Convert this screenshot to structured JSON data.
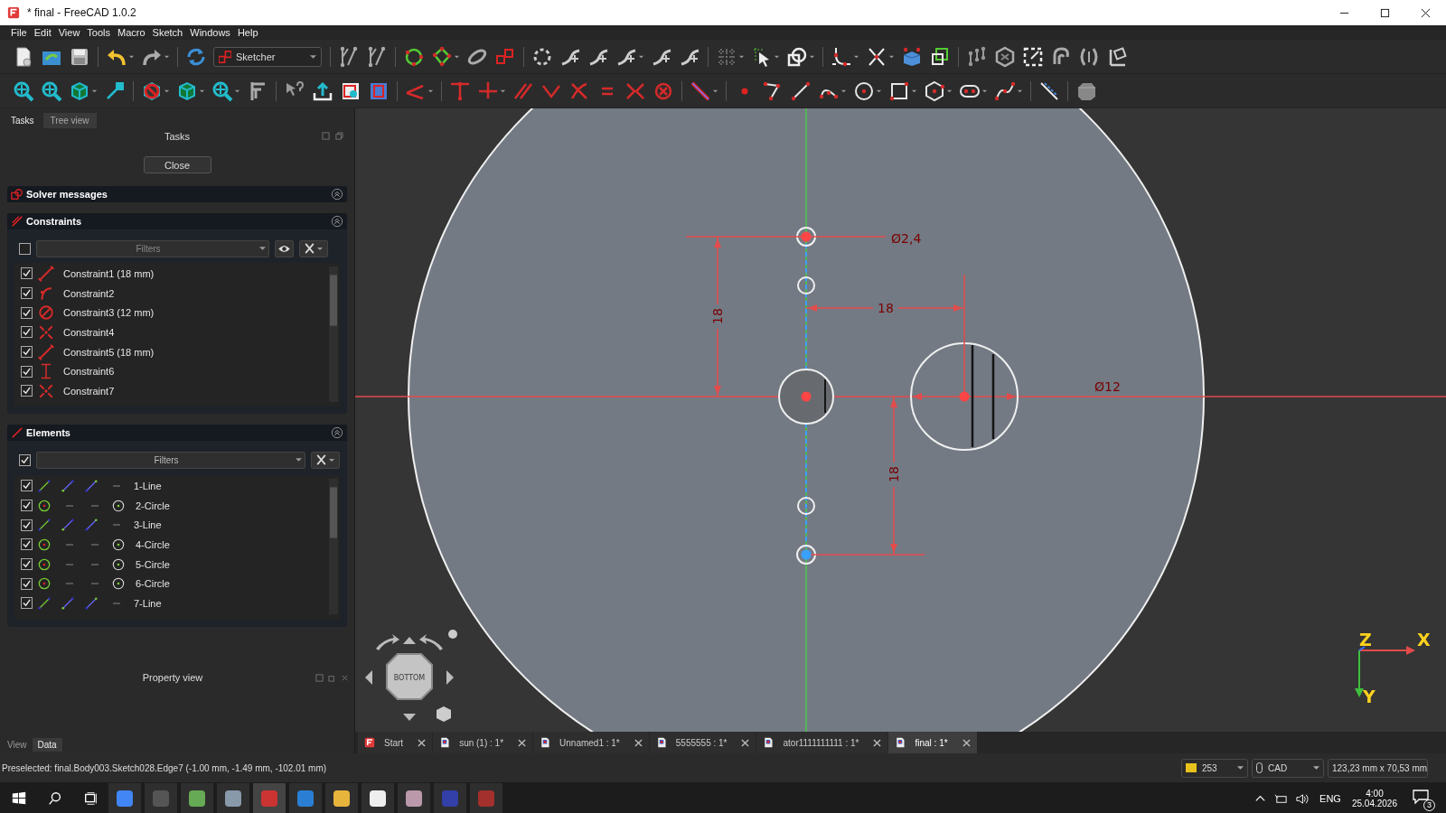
{
  "window": {
    "title": "* final - FreeCAD 1.0.2"
  },
  "menu": [
    "File",
    "Edit",
    "View",
    "Tools",
    "Macro",
    "Sketch",
    "Windows",
    "Help"
  ],
  "toolbar": {
    "workbench": "Sketcher"
  },
  "panel_tabs": [
    {
      "label": "Tasks",
      "selected": true
    },
    {
      "label": "Tree view",
      "selected": false
    }
  ],
  "tasks": {
    "title": "Tasks",
    "close_button": "Close",
    "solver_messages": {
      "title": "Solver messages"
    },
    "constraints": {
      "title": "Constraints",
      "all_checked": false,
      "filter": "Filters",
      "items": [
        {
          "label": "Constraint1 (18 mm)",
          "kind": "distance",
          "checked": true
        },
        {
          "label": "Constraint2",
          "kind": "arc",
          "checked": true
        },
        {
          "label": "Constraint3 (12 mm)",
          "kind": "diameter",
          "checked": true
        },
        {
          "label": "Constraint4",
          "kind": "symmetric",
          "checked": true
        },
        {
          "label": "Constraint5 (18 mm)",
          "kind": "distance",
          "checked": true
        },
        {
          "label": "Constraint6",
          "kind": "vertical",
          "checked": true
        },
        {
          "label": "Constraint7",
          "kind": "symmetric",
          "checked": true
        }
      ]
    },
    "elements": {
      "title": "Elements",
      "all_checked": true,
      "filter": "Filters",
      "items": [
        {
          "label": "1-Line",
          "kind": "line",
          "checked": true
        },
        {
          "label": "2-Circle",
          "kind": "circle",
          "checked": true
        },
        {
          "label": "3-Line",
          "kind": "line",
          "checked": true
        },
        {
          "label": "4-Circle",
          "kind": "circle",
          "checked": true
        },
        {
          "label": "5-Circle",
          "kind": "circle",
          "checked": true
        },
        {
          "label": "6-Circle",
          "kind": "circle",
          "checked": true
        },
        {
          "label": "7-Line",
          "kind": "line",
          "checked": true
        }
      ]
    }
  },
  "property_view": {
    "title": "Property view",
    "tabs": [
      {
        "label": "View",
        "selected": false
      },
      {
        "label": "Data",
        "selected": true
      }
    ]
  },
  "sketch": {
    "dimension_labels": [
      "Ø2,4",
      "18",
      "18",
      "18",
      "Ø12"
    ],
    "nav_cube_face": "BOTTOM",
    "axis_labels": [
      "Z",
      "X",
      "Y"
    ]
  },
  "document_tabs": [
    {
      "label": "Start",
      "kind": "start",
      "selected": false
    },
    {
      "label": "sun (1) : 1*",
      "kind": "document",
      "selected": false
    },
    {
      "label": "Unnamed1 : 1*",
      "kind": "document",
      "selected": false
    },
    {
      "label": "5555555 : 1*",
      "kind": "document",
      "selected": false
    },
    {
      "label": "ator1111111111 : 1*",
      "kind": "document",
      "selected": false
    },
    {
      "label": "final : 1*",
      "kind": "document",
      "selected": true
    }
  ],
  "status_bar": {
    "message": "Preselected: final.Body003.Sketch028.Edge7 (-1.00 mm, -1.49 mm, -102.01 mm)",
    "draw_style": "253",
    "navigation": "CAD",
    "dimensions": "123,23 mm x 70,53 mm"
  },
  "taskbar": {
    "language": "ENG",
    "time": "4:00",
    "date": "25.04.2026",
    "notifications": "3"
  }
}
